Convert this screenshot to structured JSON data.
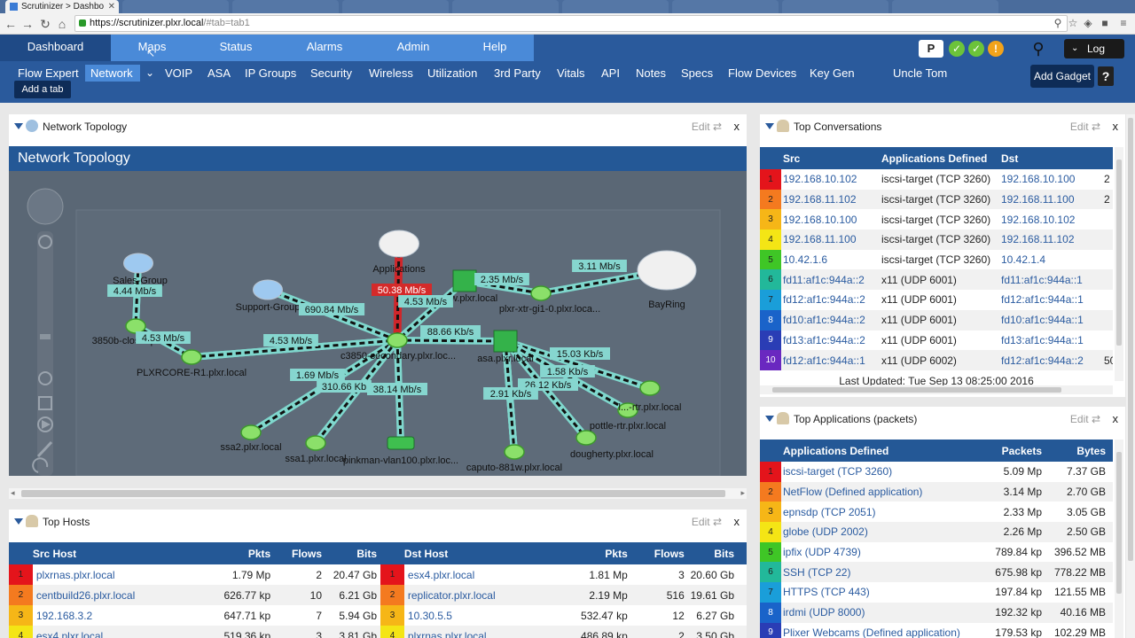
{
  "browser": {
    "tab_title": "Scrutinizer > Dashbo",
    "url_host": "https://scrutinizer.plxr.local",
    "url_rest": "/#tab=tab1"
  },
  "main_nav": [
    {
      "label": "Dashboard"
    },
    {
      "label": "Maps"
    },
    {
      "label": "Status"
    },
    {
      "label": "Alarms"
    },
    {
      "label": "Admin"
    },
    {
      "label": "Help"
    }
  ],
  "header_right": {
    "logout_label": "Log Out",
    "badge_letter": "P"
  },
  "sub_nav": [
    {
      "label": "Flow Expert"
    },
    {
      "label": "Network"
    },
    {
      "label": "VOIP"
    },
    {
      "label": "ASA"
    },
    {
      "label": "IP Groups"
    },
    {
      "label": "Security"
    },
    {
      "label": "Wireless"
    },
    {
      "label": "Utilization"
    },
    {
      "label": "3rd Party"
    },
    {
      "label": "Vitals"
    },
    {
      "label": "API"
    },
    {
      "label": "Notes"
    },
    {
      "label": "Specs"
    },
    {
      "label": "Flow Devices"
    },
    {
      "label": "Key Gen"
    },
    {
      "label": "Uncle Tom"
    }
  ],
  "add_tab_label": "Add a tab",
  "add_gadget_label": "Add Gadget",
  "help_label": "?",
  "edit_label": "Edit",
  "close_label": "x",
  "topology": {
    "panel_title": "Network Topology",
    "header": "Network Topology",
    "nodes": [
      {
        "label": "Sales-Group"
      },
      {
        "label": "Support-Group"
      },
      {
        "label": "Applications"
      },
      {
        "label": "3850b-closet.plxr.local"
      },
      {
        "label": "PLXRCORE-R1.plxr.local"
      },
      {
        "label": "c3850-secondary.plxr.loc..."
      },
      {
        "label": "asa.plxr.local"
      },
      {
        "label": "...w.plxr.local"
      },
      {
        "label": "plxr-xtr-gi1-0.plxr.loca..."
      },
      {
        "label": "BayRing"
      },
      {
        "label": "ssa2.plxr.local"
      },
      {
        "label": "ssa1.plxr.local"
      },
      {
        "label": "pinkman-vlan100.plxr.loc..."
      },
      {
        "label": "caputo-881w.plxr.local"
      },
      {
        "label": "dougherty.plxr.local"
      },
      {
        "label": "pottle-rtr.plxr.local"
      },
      {
        "label": "l...-rtr.plxr.local"
      }
    ],
    "links": [
      {
        "label": "4.44 Mb/s"
      },
      {
        "label": "690.84 Mb/s"
      },
      {
        "label": "4.53 Mb/s"
      },
      {
        "label": "4.53 Mb/s"
      },
      {
        "label": "50.38 Mb/s"
      },
      {
        "label": "4.53 Mb/s"
      },
      {
        "label": "2.35 Mb/s"
      },
      {
        "label": "3.11 Mb/s"
      },
      {
        "label": "88.66 Kb/s"
      },
      {
        "label": "1.69 Mb/s"
      },
      {
        "label": "310.66 Kb"
      },
      {
        "label": "38.14 Mb/s"
      },
      {
        "label": "15.03 Kb/s"
      },
      {
        "label": "1.58 Kb/s"
      },
      {
        "label": "26.12 Kb/s"
      },
      {
        "label": "2.91 Kb/s"
      }
    ]
  },
  "top_hosts": {
    "title": "Top Hosts",
    "src_cols": [
      "Src Host",
      "Pkts",
      "Flows",
      "Bits"
    ],
    "dst_cols": [
      "Dst Host",
      "Pkts",
      "Flows",
      "Bits"
    ],
    "rows": [
      {
        "rank": "1",
        "src": "plxrnas.plxr.local",
        "spkts": "1.79 Mp",
        "sflows": "2",
        "sbits": "20.47 Gb",
        "dst": "esx4.plxr.local",
        "dpkts": "1.81 Mp",
        "dflows": "3",
        "dbits": "20.60 Gb"
      },
      {
        "rank": "2",
        "src": "centbuild26.plxr.local",
        "spkts": "626.77 kp",
        "sflows": "10",
        "sbits": "6.21 Gb",
        "dst": "replicator.plxr.local",
        "dpkts": "2.19 Mp",
        "dflows": "516",
        "dbits": "19.61 Gb"
      },
      {
        "rank": "3",
        "src": "192.168.3.2",
        "spkts": "647.71 kp",
        "sflows": "7",
        "sbits": "5.94 Gb",
        "dst": "10.30.5.5",
        "dpkts": "532.47 kp",
        "dflows": "12",
        "dbits": "6.27 Gb"
      },
      {
        "rank": "4",
        "src": "esx4.plxr.local",
        "spkts": "519.36 kp",
        "sflows": "3",
        "sbits": "3.81 Gb",
        "dst": "plxrnas.plxr.local",
        "dpkts": "486.89 kp",
        "dflows": "2",
        "dbits": "3.50 Gb"
      }
    ]
  },
  "top_conversations": {
    "title": "Top Conversations",
    "cols": [
      "Src",
      "Applications Defined",
      "Dst"
    ],
    "rows": [
      {
        "rank": "1",
        "src": "192.168.10.102",
        "app": "iscsi-target (TCP 3260)",
        "dst": "192.168.10.100",
        "extra": "2"
      },
      {
        "rank": "2",
        "src": "192.168.11.102",
        "app": "iscsi-target (TCP 3260)",
        "dst": "192.168.11.100",
        "extra": "2"
      },
      {
        "rank": "3",
        "src": "192.168.10.100",
        "app": "iscsi-target (TCP 3260)",
        "dst": "192.168.10.102",
        "extra": ""
      },
      {
        "rank": "4",
        "src": "192.168.11.100",
        "app": "iscsi-target (TCP 3260)",
        "dst": "192.168.11.102",
        "extra": ""
      },
      {
        "rank": "5",
        "src": "10.42.1.6",
        "app": "iscsi-target (TCP 3260)",
        "dst": "10.42.1.4",
        "extra": ""
      },
      {
        "rank": "6",
        "src": "fd11:af1c:944a::2",
        "app": "x11 (UDP 6001)",
        "dst": "fd11:af1c:944a::1",
        "extra": ""
      },
      {
        "rank": "7",
        "src": "fd12:af1c:944a::2",
        "app": "x11 (UDP 6001)",
        "dst": "fd12:af1c:944a::1",
        "extra": ""
      },
      {
        "rank": "8",
        "src": "fd10:af1c:944a::2",
        "app": "x11 (UDP 6001)",
        "dst": "fd10:af1c:944a::1",
        "extra": ""
      },
      {
        "rank": "9",
        "src": "fd13:af1c:944a::2",
        "app": "x11 (UDP 6001)",
        "dst": "fd13:af1c:944a::1",
        "extra": ""
      },
      {
        "rank": "10",
        "src": "fd12:af1c:944a::1",
        "app": "x11 (UDP 6002)",
        "dst": "fd12:af1c:944a::2",
        "extra": "50"
      }
    ],
    "last_updated": "Last Updated: Tue Sep 13 08:25:00 2016"
  },
  "top_applications": {
    "title": "Top Applications (packets)",
    "cols": [
      "Applications Defined",
      "Packets",
      "Bytes"
    ],
    "rows": [
      {
        "rank": "1",
        "app": "iscsi-target (TCP 3260)",
        "packets": "5.09 Mp",
        "bytes": "7.37 GB"
      },
      {
        "rank": "2",
        "app": "NetFlow (Defined application)",
        "packets": "3.14 Mp",
        "bytes": "2.70 GB"
      },
      {
        "rank": "3",
        "app": "epnsdp (TCP 2051)",
        "packets": "2.33 Mp",
        "bytes": "3.05 GB"
      },
      {
        "rank": "4",
        "app": "globe (UDP 2002)",
        "packets": "2.26 Mp",
        "bytes": "2.50 GB"
      },
      {
        "rank": "5",
        "app": "ipfix (UDP 4739)",
        "packets": "789.84 kp",
        "bytes": "396.52 MB"
      },
      {
        "rank": "6",
        "app": "SSH (TCP 22)",
        "packets": "675.98 kp",
        "bytes": "778.22 MB"
      },
      {
        "rank": "7",
        "app": "HTTPS (TCP 443)",
        "packets": "197.84 kp",
        "bytes": "121.55 MB"
      },
      {
        "rank": "8",
        "app": "irdmi (UDP 8000)",
        "packets": "192.32 kp",
        "bytes": "40.16 MB"
      },
      {
        "rank": "9",
        "app": "Plixer Webcams (Defined application)",
        "packets": "179.53 kp",
        "bytes": "102.29 MB"
      }
    ]
  },
  "rank_colors": [
    "#e4141b",
    "#f47a1f",
    "#f6b617",
    "#f4e515",
    "#3fc626",
    "#22b89a",
    "#1a9ed9",
    "#1a63c9",
    "#2a3db5",
    "#6a28c0"
  ]
}
